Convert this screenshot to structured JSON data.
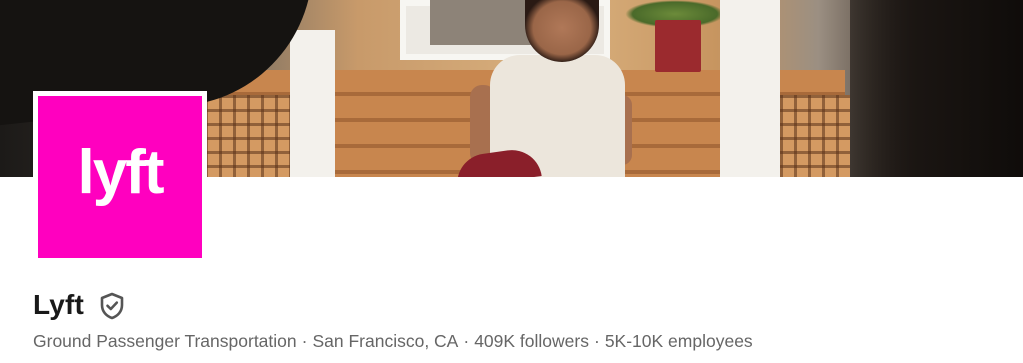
{
  "cover": {
    "image_description_icon": "cover-photo"
  },
  "logo": {
    "text": "lyft",
    "background_color": "#ff00bf",
    "text_color": "#ffffff"
  },
  "company": {
    "name": "Lyft",
    "verified_icon": "verified-shield-icon",
    "industry": "Ground Passenger Transportation",
    "location": "San Francisco, CA",
    "followers": "409K followers",
    "employees": "5K-10K employees",
    "separator": "·"
  }
}
